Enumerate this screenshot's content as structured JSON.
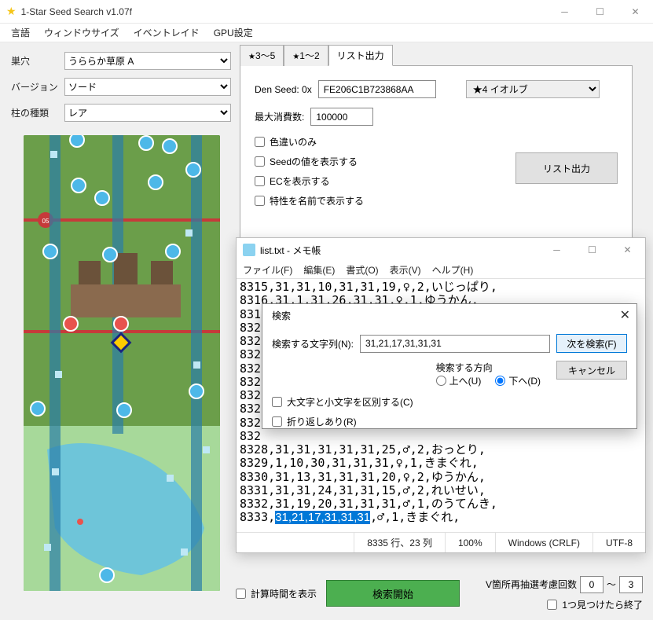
{
  "window": {
    "title": "1-Star Seed Search v1.07f",
    "menu": [
      "言語",
      "ウィンドウサイズ",
      "イベントレイド",
      "GPU設定"
    ]
  },
  "left": {
    "den_label": "巣穴",
    "den_value": "うららか草原 A",
    "version_label": "バージョン",
    "version_value": "ソード",
    "pillar_label": "柱の種類",
    "pillar_value": "レア"
  },
  "tabs": {
    "t1": "3〜5",
    "t2": "1〜2",
    "t3": "リスト出力"
  },
  "panel": {
    "seed_label": "Den Seed: 0x",
    "seed_value": "FE206C1B723868AA",
    "target_value": "★4 イオルブ",
    "max_label": "最大消費数:",
    "max_value": "100000",
    "cb_shiny": "色違いのみ",
    "cb_seed": "Seedの値を表示する",
    "cb_ec": "ECを表示する",
    "cb_ability": "特性を名前で表示する",
    "list_btn": "リスト出力"
  },
  "bottom": {
    "cb_time": "計算時間を表示",
    "search_btn": "検索開始",
    "reroll_label": "V箇所再抽選考慮回数",
    "reroll_min": "0",
    "reroll_tilde": "〜",
    "reroll_max": "3",
    "cb_stop": "1つ見つけたら終了"
  },
  "notepad": {
    "title": "list.txt - メモ帳",
    "menu": [
      "ファイル(F)",
      "編集(E)",
      "書式(O)",
      "表示(V)",
      "ヘルプ(H)"
    ],
    "lines_top": [
      "8315,31,31,10,31,31,19,♀,2,いじっぱり,",
      "8316,31,1,31,26,31,31,♀,1,ゆうかん,"
    ],
    "lines_mid_prefix": [
      "831",
      "832",
      "832",
      "832",
      "832",
      "832",
      "832",
      "832",
      "832",
      "832"
    ],
    "lines_bot": [
      "8328,31,31,31,31,31,25,♂,2,おっとり,",
      "8329,1,10,30,31,31,31,♀,1,きまぐれ,",
      "8330,31,13,31,31,31,20,♀,2,ゆうかん,",
      "8331,31,31,24,31,31,15,♂,2,れいせい,",
      "8332,31,19,20,31,31,31,♂,1,のうてんき,"
    ],
    "hl_row_prefix": "8333,",
    "hl_row_highlight": "31,21,17,31,31,31",
    "hl_row_suffix": ",♂,1,きまぐれ,",
    "status": {
      "pos": "8335 行、23 列",
      "zoom": "100%",
      "eol": "Windows (CRLF)",
      "enc": "UTF-8"
    }
  },
  "search": {
    "title": "検索",
    "label": "検索する文字列(N):",
    "value": "31,21,17,31,31,31",
    "find_next": "次を検索(F)",
    "cancel": "キャンセル",
    "dir_label": "検索する方向",
    "dir_up": "上へ(U)",
    "dir_down": "下へ(D)",
    "cb_case": "大文字と小文字を区別する(C)",
    "cb_wrap": "折り返しあり(R)"
  }
}
